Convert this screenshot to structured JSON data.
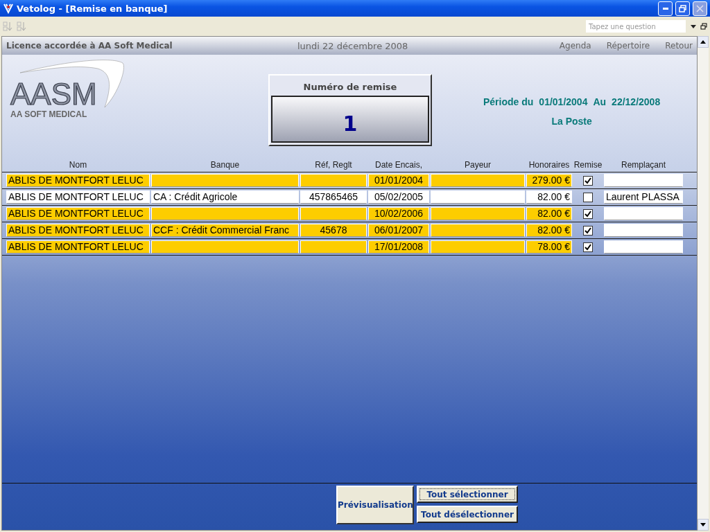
{
  "window": {
    "title": "Vetolog - [Remise en banque]"
  },
  "toolbar": {
    "question_placeholder": "Tapez une question"
  },
  "header": {
    "license": "Licence accordée à AA Soft Medical",
    "date": "lundi 22 décembre 2008",
    "links": [
      "Agenda",
      "Répertoire",
      "Retour"
    ]
  },
  "logo": {
    "mark": "AASM",
    "name": "AA SOFT MEDICAL"
  },
  "remise": {
    "label": "Numéro de remise",
    "number": "1"
  },
  "period": {
    "label": "Période du",
    "from": "01/01/2004",
    "to_label": "Au",
    "to": "22/12/2008",
    "bank": "La Poste"
  },
  "table": {
    "columns": [
      "Nom",
      "Banque",
      "Réf, Reglt",
      "Date Encais,",
      "Payeur",
      "Honoraires",
      "Remise",
      "Remplaçant"
    ],
    "rows": [
      {
        "nom": "ABLIS DE MONTFORT LELUC",
        "banque": "",
        "ref": "",
        "date": "01/01/2004",
        "payeur": "",
        "honoraires": "279.00 €",
        "checked": true,
        "remplacant": ""
      },
      {
        "nom": "ABLIS DE MONTFORT LELUC",
        "banque": "CA : Crédit Agricole",
        "ref": "457865465",
        "date": "05/02/2005",
        "payeur": "",
        "honoraires": "82.00 €",
        "checked": false,
        "remplacant": "Laurent PLASSA"
      },
      {
        "nom": "ABLIS DE MONTFORT LELUC",
        "banque": "",
        "ref": "",
        "date": "10/02/2006",
        "payeur": "",
        "honoraires": "82.00 €",
        "checked": true,
        "remplacant": ""
      },
      {
        "nom": "ABLIS DE MONTFORT LELUC",
        "banque": "CCF : Crédit Commercial Franc",
        "ref": "45678",
        "date": "06/01/2007",
        "payeur": "",
        "honoraires": "82.00 €",
        "checked": true,
        "remplacant": ""
      },
      {
        "nom": "ABLIS DE MONTFORT LELUC",
        "banque": "",
        "ref": "",
        "date": "17/01/2008",
        "payeur": "",
        "honoraires": "78.00 €",
        "checked": true,
        "remplacant": ""
      }
    ]
  },
  "buttons": {
    "preview": "Prévisualisation",
    "select_all": "Tout sélectionner",
    "deselect_all": "Tout désélectionner"
  }
}
